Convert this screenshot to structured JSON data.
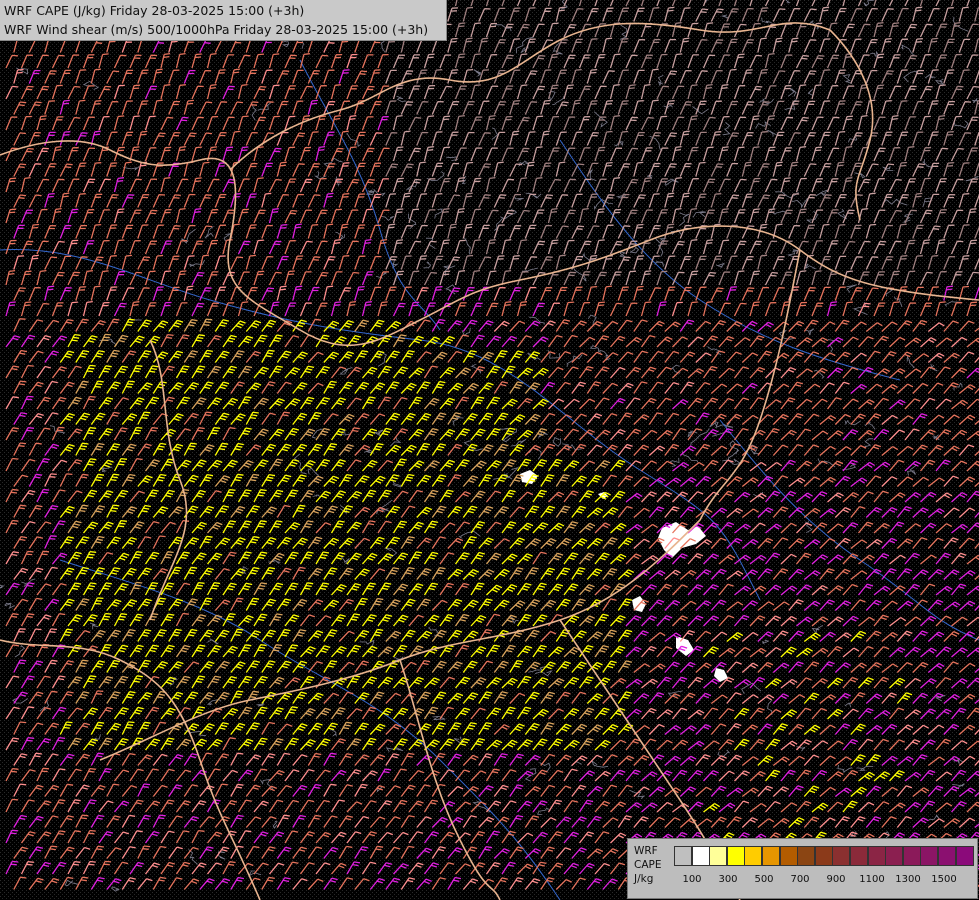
{
  "header": {
    "title_cape": "WRF CAPE (J/kg) Friday 28-03-2025 15:00 (+3h)",
    "title_shear": "WRF Wind shear (m/s) 500/1000hPa Friday 28-03-2025 15:00 (+3h)"
  },
  "legend": {
    "label_lines": [
      "WRF",
      "CAPE",
      "J/kg"
    ],
    "tick_labels": [
      "100",
      "300",
      "500",
      "700",
      "900",
      "1100",
      "1300",
      "1500"
    ],
    "swatch_colors": [
      "#bfbfbf",
      "#ffffff",
      "#ffff99",
      "#ffff00",
      "#ffcc00",
      "#e69500",
      "#b35c00",
      "#8b4513",
      "#8b3a1a",
      "#8b3030",
      "#8b2a3a",
      "#8b2545",
      "#8b1f50",
      "#8b1a5a",
      "#8b1565",
      "#8b1070",
      "#8b0a7a"
    ]
  },
  "map_colors": {
    "background": "#000000",
    "border": "#e8b48f",
    "river": "#3366cc",
    "contour": "#7a7a8a",
    "barb_pink": "#ff8f8f",
    "barb_salmon": "#e6735c",
    "barb_magenta": "#e020e0",
    "barb_yellow": "#ffff00",
    "barb_tan": "#d9a35c",
    "barb_grey": "#c8a0a0",
    "cape_white": "#ffffff"
  },
  "icons": [
    "wind-barb-icon"
  ]
}
